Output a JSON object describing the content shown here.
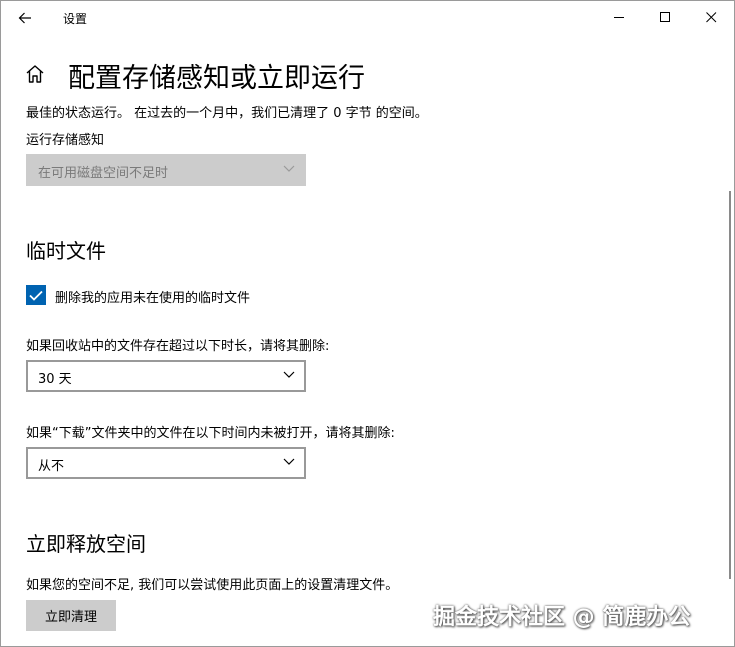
{
  "titlebar": {
    "title": "设置",
    "icons": {
      "back": "arrow-left-icon",
      "minimize": "minimize-icon",
      "maximize": "maximize-icon",
      "close": "close-icon"
    }
  },
  "page": {
    "home_icon": "home-icon",
    "title": "配置存储感知或立即运行",
    "status": "最佳的状态运行。 在过去的一个月中，我们已清理了 0 字节 的空间。"
  },
  "run_storage_sense": {
    "label": "运行存储感知",
    "value": "在可用磁盘空间不足时",
    "disabled": true
  },
  "temp_files": {
    "title": "临时文件",
    "checkbox_label": "删除我的应用未在使用的临时文件",
    "checked": true,
    "recycle_label": "如果回收站中的文件存在超过以下时长，请将其删除:",
    "recycle_value": "30 天",
    "downloads_label": "如果“下载”文件夹中的文件在以下时间内未被打开，请将其删除:",
    "downloads_value": "从不"
  },
  "free_space": {
    "title": "立即释放空间",
    "description": "如果您的空间不足, 我们可以尝试使用此页面上的设置清理文件。",
    "button": "立即清理"
  },
  "watermark": "掘金技术社区 @ 简鹿办公",
  "colors": {
    "accent": "#0063b1",
    "disabled_bg": "#cccccc",
    "button_bg": "#cccccc"
  }
}
